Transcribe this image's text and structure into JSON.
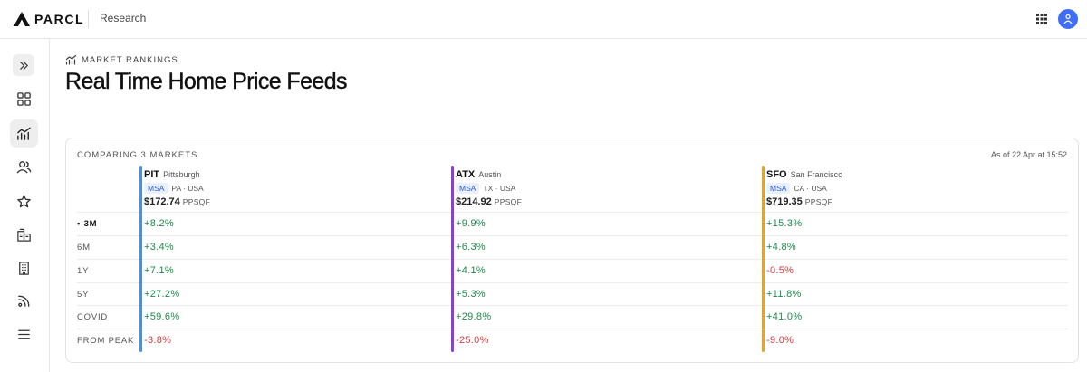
{
  "header": {
    "brand": "PARCL",
    "section": "Research"
  },
  "sidebar": {
    "items": [
      {
        "icon": "chevrons-right-icon"
      },
      {
        "icon": "grid-icon"
      },
      {
        "icon": "chart-icon",
        "active": true
      },
      {
        "icon": "users-icon"
      },
      {
        "icon": "star-icon"
      },
      {
        "icon": "buildings-icon"
      },
      {
        "icon": "building-icon"
      },
      {
        "icon": "signal-icon"
      },
      {
        "icon": "menu-icon"
      }
    ]
  },
  "page": {
    "eyebrow": "MARKET RANKINGS",
    "title": "Real Time Home Price Feeds"
  },
  "comparison": {
    "heading": "COMPARING 3 MARKETS",
    "as_of": "As of 22 Apr at 15:52",
    "periods": [
      "• 3M",
      "6M",
      "1Y",
      "5Y",
      "COVID",
      "FROM PEAK"
    ],
    "selected_period": 0,
    "markets": [
      {
        "code": "PIT",
        "name": "Pittsburgh",
        "type": "MSA",
        "location": "PA · USA",
        "price": "$172.74",
        "unit": "PPSQF",
        "color": "#4a90e2",
        "values": [
          "+8.2%",
          "+3.4%",
          "+7.1%",
          "+27.2%",
          "+59.6%",
          "-3.8%"
        ]
      },
      {
        "code": "ATX",
        "name": "Austin",
        "type": "MSA",
        "location": "TX · USA",
        "price": "$214.92",
        "unit": "PPSQF",
        "color": "#8a3fd1",
        "values": [
          "+9.9%",
          "+6.3%",
          "+4.1%",
          "+5.3%",
          "+29.8%",
          "-25.0%"
        ]
      },
      {
        "code": "SFO",
        "name": "San Francisco",
        "type": "MSA",
        "location": "CA · USA",
        "price": "$719.35",
        "unit": "PPSQF",
        "color": "#f0a020",
        "values": [
          "+15.3%",
          "+4.8%",
          "-0.5%",
          "+11.8%",
          "+41.0%",
          "-9.0%"
        ]
      }
    ]
  }
}
